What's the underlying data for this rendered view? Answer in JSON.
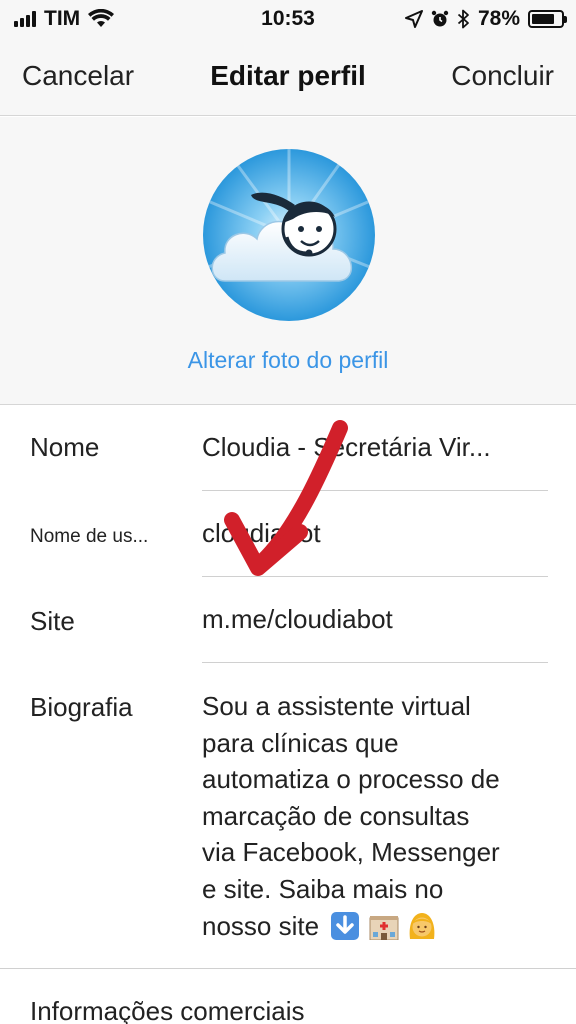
{
  "status_bar": {
    "carrier": "TIM",
    "time": "10:53",
    "battery": "78%",
    "battery_level": 0.78
  },
  "nav": {
    "cancel_label": "Cancelar",
    "title": "Editar perfil",
    "done_label": "Concluir"
  },
  "photo": {
    "change_label": "Alterar foto do perfil"
  },
  "form": {
    "name_label": "Nome",
    "name_value": "Cloudia - Secretária Vir...",
    "username_label": "Nome de us...",
    "username_value": "cloudiabot",
    "site_label": "Site",
    "site_value": "m.me/cloudiabot",
    "bio_label": "Biografia",
    "bio_lines": [
      "Sou a assistente virtual",
      "para clínicas que",
      "automatiza o processo de",
      "marcação de consultas",
      "via Facebook, Messenger",
      "e site. Saiba mais no",
      "nosso site"
    ],
    "bio_emojis": [
      "down-arrow-emoji",
      "hospital-emoji",
      "woman-emoji"
    ],
    "commercial_label": "Informações comerciais"
  },
  "colors": {
    "link": "#3b95e6",
    "arrow": "#d1202a",
    "avatar_bg": "#2a9be0"
  }
}
